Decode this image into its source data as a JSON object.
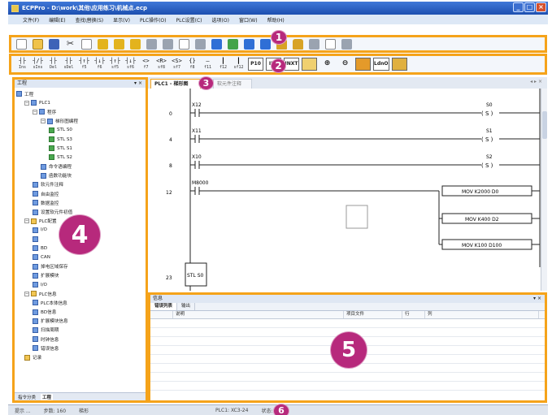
{
  "window": {
    "title": "ECPPro - D:\\work\\其他\\应用练习\\机械点.ecp",
    "min": "_",
    "max": "□",
    "close": "×"
  },
  "menu": [
    "文件(F)",
    "编辑(E)",
    "查找\\替换(S)",
    "显示(V)",
    "PLC操作(O)",
    "PLC设置(C)",
    "选项(O)",
    "窗口(W)",
    "帮助(H)"
  ],
  "toolbar1": {
    "icons": [
      "new-icon",
      "open-icon",
      "save-icon",
      "cut-icon",
      "copy-icon",
      "paste-icon",
      "undo-icon",
      "redo-icon",
      "find-icon",
      "print-icon",
      "monitor-icon",
      "compile-icon",
      "write-icon",
      "upload-icon",
      "download-icon",
      "run-icon",
      "stop-icon",
      "lock-icon",
      "unlock-icon",
      "window-icon",
      "preview-icon",
      "help-icon"
    ],
    "cut_glyph": "✂"
  },
  "toolbar2": {
    "buttons": [
      {
        "sym": "┤├",
        "key": "Ins"
      },
      {
        "sym": "┤/├",
        "key": "sIns"
      },
      {
        "sym": "┤├",
        "key": "Del"
      },
      {
        "sym": "┤├",
        "key": "sDel"
      },
      {
        "sym": "┤↑├",
        "key": "f5"
      },
      {
        "sym": "┤↓├",
        "key": "f6"
      },
      {
        "sym": "┤↑├",
        "key": "sf5"
      },
      {
        "sym": "┤↓├",
        "key": "sf6"
      },
      {
        "sym": "<>",
        "key": "f7"
      },
      {
        "sym": "<R>",
        "key": "sf8"
      },
      {
        "sym": "<S>",
        "key": "sf7"
      },
      {
        "sym": "{}",
        "key": "f8"
      },
      {
        "sym": "—",
        "key": "f11"
      },
      {
        "sym": "┃",
        "key": "f12"
      },
      {
        "sym": "┃",
        "key": "sf12"
      }
    ],
    "big": [
      "P10",
      "IIIII",
      "INXT",
      "",
      "",
      "",
      "LdnO",
      ""
    ]
  },
  "badges": {
    "b1": "1",
    "b2": "2",
    "b3": "3",
    "b4": "4",
    "b5": "5",
    "b6": "6"
  },
  "left_panel": {
    "title": "工程",
    "pin": "▾ ×",
    "tree": [
      {
        "label": "工程",
        "indent": 0,
        "icon": "blu",
        "exp": ""
      },
      {
        "label": "PLC1",
        "indent": 1,
        "icon": "blu",
        "exp": "−"
      },
      {
        "label": "程序",
        "indent": 2,
        "icon": "blu",
        "exp": "−"
      },
      {
        "label": "梯形图编程",
        "indent": 3,
        "icon": "blu",
        "exp": "−"
      },
      {
        "label": "STL S0",
        "indent": 4,
        "icon": "grn",
        "exp": ""
      },
      {
        "label": "STL S3",
        "indent": 4,
        "icon": "grn",
        "exp": ""
      },
      {
        "label": "STL S1",
        "indent": 4,
        "icon": "grn",
        "exp": ""
      },
      {
        "label": "STL S2",
        "indent": 4,
        "icon": "grn",
        "exp": ""
      },
      {
        "label": "命令语编程",
        "indent": 3,
        "icon": "blu",
        "exp": ""
      },
      {
        "label": "函数功能块",
        "indent": 3,
        "icon": "blu",
        "exp": ""
      },
      {
        "label": "软元件注释",
        "indent": 2,
        "icon": "blu",
        "exp": ""
      },
      {
        "label": "自由监控",
        "indent": 2,
        "icon": "blu",
        "exp": ""
      },
      {
        "label": "数据监控",
        "indent": 2,
        "icon": "blu",
        "exp": ""
      },
      {
        "label": "设置软元件初值",
        "indent": 2,
        "icon": "blu",
        "exp": ""
      },
      {
        "label": "PLC配置",
        "indent": 1,
        "icon": "fold",
        "exp": "−"
      },
      {
        "label": "I/O",
        "indent": 2,
        "icon": "blu",
        "exp": ""
      },
      {
        "label": "",
        "indent": 2,
        "icon": "blu",
        "exp": ""
      },
      {
        "label": "BD",
        "indent": 2,
        "icon": "blu",
        "exp": ""
      },
      {
        "label": "CAN",
        "indent": 2,
        "icon": "blu",
        "exp": ""
      },
      {
        "label": "掉电区域保存",
        "indent": 2,
        "icon": "blu",
        "exp": ""
      },
      {
        "label": "扩展模块",
        "indent": 2,
        "icon": "blu",
        "exp": ""
      },
      {
        "label": "I/O",
        "indent": 2,
        "icon": "blu",
        "exp": ""
      },
      {
        "label": "PLC信息",
        "indent": 1,
        "icon": "fold",
        "exp": "−"
      },
      {
        "label": "PLC本体信息",
        "indent": 2,
        "icon": "blu",
        "exp": ""
      },
      {
        "label": "BD信息",
        "indent": 2,
        "icon": "blu",
        "exp": ""
      },
      {
        "label": "扩展模块信息",
        "indent": 2,
        "icon": "blu",
        "exp": ""
      },
      {
        "label": "扫描周期",
        "indent": 2,
        "icon": "blu",
        "exp": ""
      },
      {
        "label": "时钟信息",
        "indent": 2,
        "icon": "blu",
        "exp": ""
      },
      {
        "label": "错误信息",
        "indent": 2,
        "icon": "blu",
        "exp": ""
      },
      {
        "label": "记录",
        "indent": 1,
        "icon": "fold",
        "exp": ""
      }
    ],
    "tabs": [
      "指令分类",
      "工程"
    ]
  },
  "editor": {
    "tabs": [
      "PLC1 - 梯形图",
      "软元件注释"
    ],
    "controls": "◂ ▸ ×",
    "rungs": [
      {
        "step": "0",
        "contact": "X12",
        "coil": "S0",
        "kind": "S"
      },
      {
        "step": "4",
        "contact": "X11",
        "coil": "S1",
        "kind": "S"
      },
      {
        "step": "8",
        "contact": "X10",
        "coil": "S2",
        "kind": "S"
      },
      {
        "step": "12",
        "contact": "M8000",
        "outputs": [
          "MOV  K2000  D0",
          "MOV  K400  D2",
          "MOV  K100  D100"
        ]
      },
      {
        "step": "23",
        "stl": "STL S0"
      }
    ]
  },
  "bottom_panel": {
    "title": "信息",
    "ctl": "▾ ×",
    "tabs": [
      "错误列表",
      "输出"
    ],
    "columns": [
      "",
      "说明",
      "项目文件",
      "行",
      "列"
    ]
  },
  "status": [
    "提示 ...",
    "步数: 160",
    "梯形",
    "PLC1: XC3-24",
    "",
    "",
    "状态: 未连接"
  ]
}
